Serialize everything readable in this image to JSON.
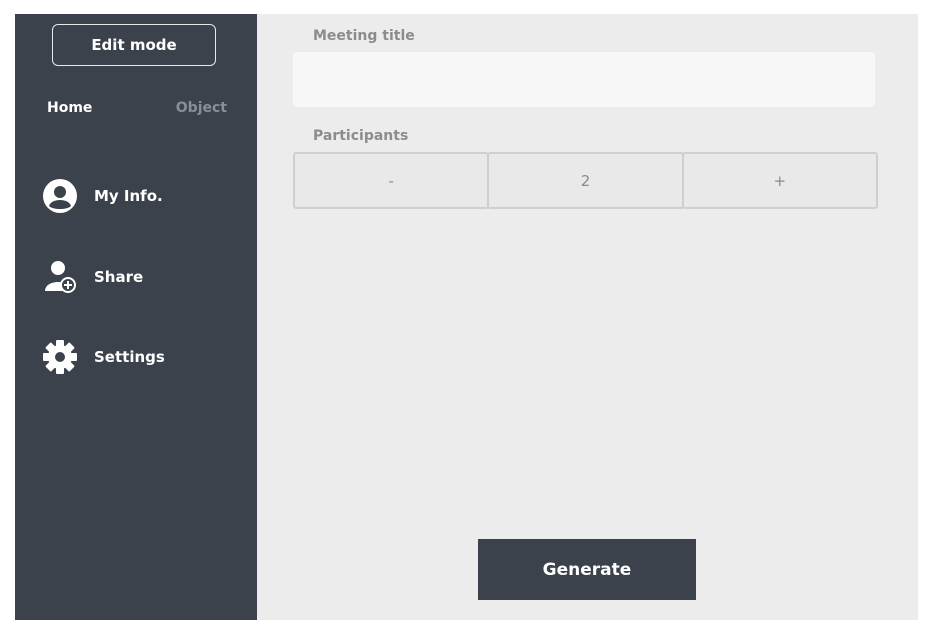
{
  "sidebar": {
    "edit_mode_label": "Edit mode",
    "tabs": [
      {
        "label": "Home",
        "active": true
      },
      {
        "label": "Object",
        "active": false
      }
    ],
    "items": [
      {
        "label": "My Info.",
        "icon": "user-circle-icon"
      },
      {
        "label": "Share",
        "icon": "share-user-icon"
      },
      {
        "label": "Settings",
        "icon": "gear-icon"
      }
    ],
    "background": "#3c424b"
  },
  "form": {
    "meeting_title_label": "Meeting title",
    "meeting_title_value": "",
    "participants_label": "Participants",
    "decrement_label": "-",
    "participants_count": "2",
    "increment_label": "+"
  },
  "generate_label": "Generate"
}
